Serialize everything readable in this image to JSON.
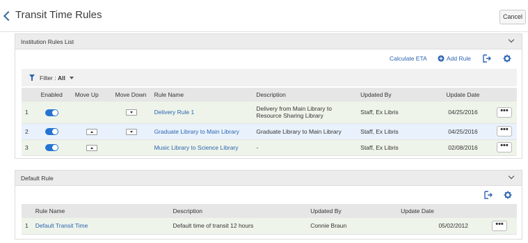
{
  "header": {
    "title": "Transit Time Rules",
    "cancel_label": "Cancel"
  },
  "institution_panel": {
    "title": "Institution Rules List",
    "calculate_label": "Calculate ETA",
    "add_rule_label": "Add Rule",
    "filter_label": "Filter :",
    "filter_value": "All",
    "columns": [
      "Enabled",
      "Move Up",
      "Move Down",
      "Rule Name",
      "Description",
      "Updated By",
      "Update Date"
    ],
    "rows": [
      {
        "num": "1",
        "name": "Delivery Rule 1",
        "description": "Delivery from Main Library to Resource Sharing Library",
        "updated_by": "Staff, Ex Libris",
        "date": "04/25/2016"
      },
      {
        "num": "2",
        "name": "Graduate Library to Main Library",
        "description": "Graduate Library to Main Library",
        "updated_by": "Staff, Ex Libris",
        "date": "04/25/2016"
      },
      {
        "num": "3",
        "name": "Music Library to Science Library",
        "description": "-",
        "updated_by": "Staff, Ex Libris",
        "date": "02/08/2016"
      }
    ],
    "more_label": "•••"
  },
  "default_panel": {
    "title": "Default Rule",
    "columns": [
      "Rule Name",
      "Description",
      "Updated By",
      "Update Date"
    ],
    "rows": [
      {
        "num": "1",
        "name": "Default Transit Time",
        "description": "Default time of transit 12 hours",
        "updated_by": "Connie Braun",
        "date": "05/02/2012"
      }
    ],
    "more_label": "•••"
  },
  "icons": {
    "back": "chevron-left-icon",
    "collapse": "chevron-down-icon",
    "add": "plus-circle-icon",
    "export": "export-icon",
    "settings": "gear-icon",
    "filter": "filter-icon"
  },
  "colors": {
    "accent": "#2b64b0",
    "toggle": "#2574d2",
    "row_green": "#eef4ea",
    "row_blue": "#e9f2fc"
  }
}
